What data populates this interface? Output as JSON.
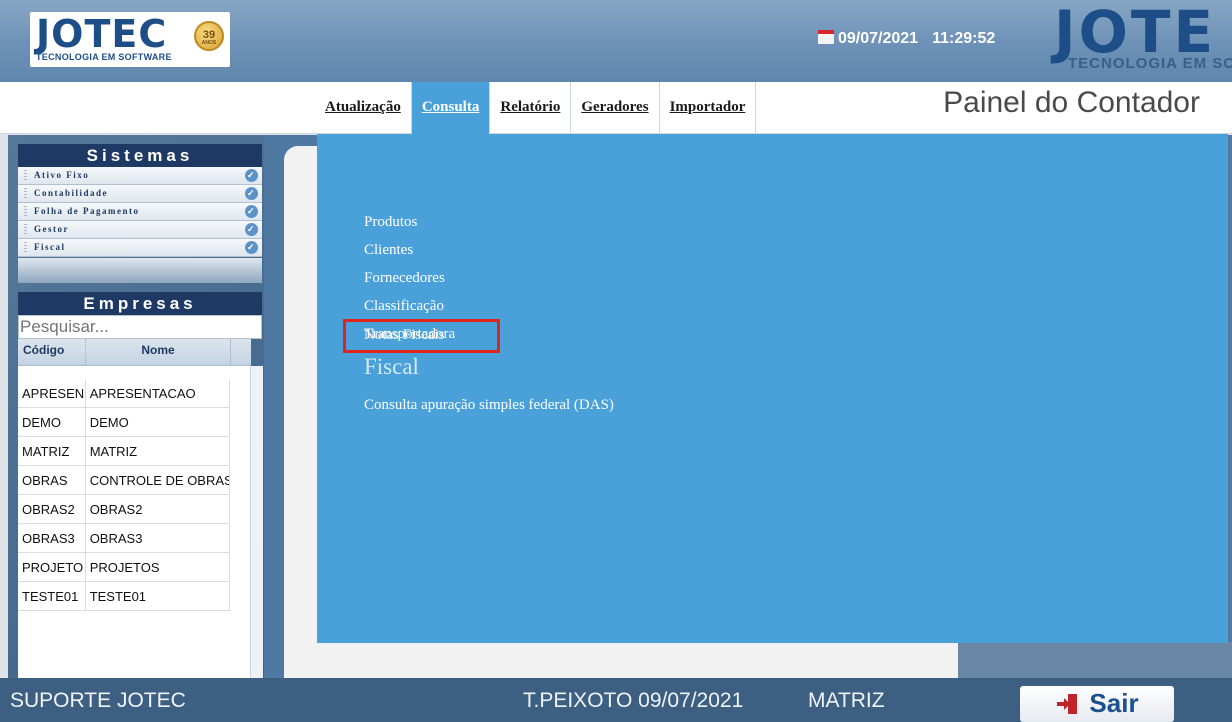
{
  "header": {
    "logo_text": "JOTEC",
    "logo_subtitle": "TECNOLOGIA EM SOFTWARE",
    "seal_number": "39",
    "seal_sub": "ANOS",
    "date": "09/07/2021",
    "time": "11:29:52",
    "brand_right": "JOTE",
    "brand_right_sub": "TECNOLOGIA EM SOFT"
  },
  "menu": {
    "items": [
      {
        "label": "Atualização"
      },
      {
        "label": "Consulta"
      },
      {
        "label": "Relatório"
      },
      {
        "label": "Geradores"
      },
      {
        "label": "Importador"
      }
    ],
    "active": "Consulta"
  },
  "panel_title": "Painel do Contador",
  "sidebar": {
    "sistemas_title": "Sistemas",
    "sistemas": [
      {
        "label": "Ativo Fixo"
      },
      {
        "label": "Contabilidade"
      },
      {
        "label": "Folha de Pagamento"
      },
      {
        "label": "Gestor"
      },
      {
        "label": "Fiscal"
      }
    ],
    "empresas_title": "Empresas",
    "search_placeholder": "Pesquisar...",
    "columns": [
      "Código",
      "Nome"
    ],
    "rows": [
      {
        "codigo": "APRESEN",
        "nome": "APRESENTACAO"
      },
      {
        "codigo": "DEMO",
        "nome": "DEMO"
      },
      {
        "codigo": "MATRIZ",
        "nome": "MATRIZ"
      },
      {
        "codigo": "OBRAS",
        "nome": "CONTROLE DE OBRAS"
      },
      {
        "codigo": "OBRAS2",
        "nome": "OBRAS2"
      },
      {
        "codigo": "OBRAS3",
        "nome": "OBRAS3"
      },
      {
        "codigo": "PROJETO",
        "nome": "PROJETOS"
      },
      {
        "codigo": "TESTE01",
        "nome": "TESTE01"
      }
    ]
  },
  "dropdown": {
    "items": [
      {
        "label": "Produtos"
      },
      {
        "label": "Clientes"
      },
      {
        "label": "Fornecedores"
      },
      {
        "label": "Classificação"
      },
      {
        "label": "Transportadora"
      },
      {
        "label": "Notas Fiscais"
      }
    ],
    "section_title": "Fiscal",
    "section_items": [
      {
        "label": "Consulta apuração simples federal (DAS)"
      }
    ],
    "highlight_color": "#e0241e"
  },
  "footer": {
    "support": "SUPORTE JOTEC",
    "user_date": "T.PEIXOTO 09/07/2021",
    "company": "MATRIZ",
    "exit_label": "Sair"
  },
  "colors": {
    "header_blue": "#6f93b8",
    "menu_active": "#4aa0d8",
    "dark_navy": "#1e3a64",
    "footer": "#3d5f82"
  }
}
